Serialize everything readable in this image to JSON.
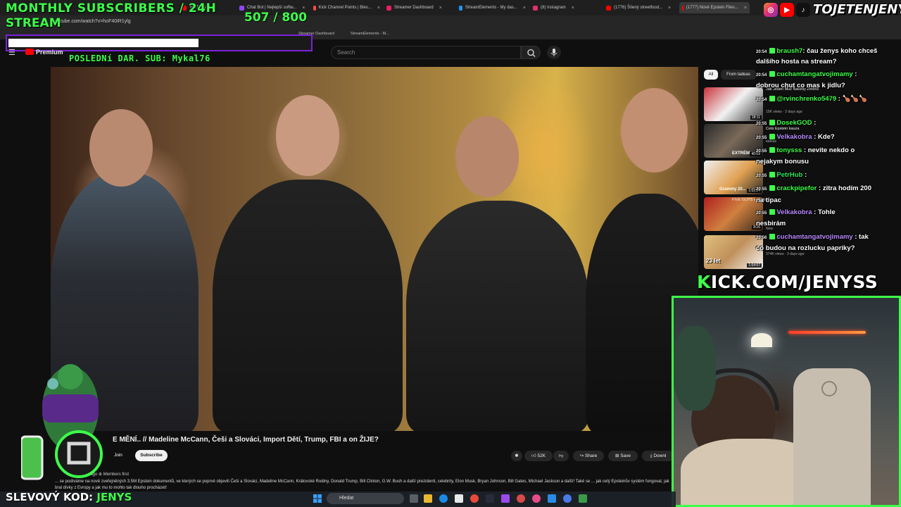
{
  "browser": {
    "tabs": [
      {
        "label": "YouTube",
        "color": "#ff0000"
      },
      {
        "label": "Chat Bot | Nejlepší softw...",
        "color": "#9146ff"
      },
      {
        "label": "Kick Channel Points | Bles...",
        "color": "#ff4a4a"
      },
      {
        "label": "Streamer Dashboard",
        "color": "#e91e63"
      },
      {
        "label": "StreamElements - My das...",
        "color": "#2196f3"
      },
      {
        "label": "(8) Instagram",
        "color": "#e1306c"
      },
      {
        "label": "(1776) Šílený streetfood...",
        "color": "#ff0000"
      },
      {
        "label": "(1777) Nové Epstein Files...",
        "color": "#ff0000"
      }
    ],
    "url": "outube.com/watch?v=hoF40iR1ylg",
    "bookmarks": [
      "Streamer Dashboard",
      "StreamElements - M..."
    ]
  },
  "overlay": {
    "sub_goal_line1": "MONTHLY SUBSCRIBERS / 24H",
    "sub_goal_line2": "STREAM",
    "sub_goal_count": "507 / 800",
    "sub_goal_progress": 0.63,
    "last_sub": "POSLEDNí DAR. SUB: Mykal76",
    "social_handle": "TOJETENJENYS",
    "kick_url_k": "K",
    "kick_url_rest": "ICK.COM/JENYSS",
    "discount_label": "SLEVOVÝ KOD:",
    "discount_code": "JENYS",
    "accent": "#3dff4a",
    "goal_border": "#7a22d8"
  },
  "youtube": {
    "logo_text": "Premium",
    "search_placeholder": "Search",
    "video_title": "E MĚNÍ.. // Madeline McCann, Češi a Slováci, Import Dětí, Trump, FBI a on ŽIJE?",
    "join_label": "Join",
    "subscribe_label": "Subscribe",
    "likes": "52K",
    "share_label": "Share",
    "save_label": "Save",
    "download_label": "Downl",
    "channel_meta": "2 d...ago   ⊕ Members first",
    "description": "... se podíváme na nově zveřejněných 3.5M Epstein dokumentů, ve kterých se poprvé objevili Češi a Slováci, Madeline McCann, Královské Rodiny, Donald Trump, Bill Clinton, G.W. Bush a další prezidenti, celebrity, Elon Musk, Bryan Johnson, Bill Gates, Michael Jackson a další! Také se ... jak celý Epsteinův systém fungoval, jak bral dívky z Evropy a jak mu to mohlo tak dlouho procházet!",
    "chips": [
      "All",
      "From tadeas"
    ],
    "recommendations": [
      {
        "title": "Jak Jeden Muž Navždy Změnil",
        "meta": "15K views · 2 days ago",
        "duration": "18:11"
      },
      {
        "title": "Celá Epstein kauza",
        "meta": "tadeas",
        "duration": "40:09"
      },
      {
        "title": "Dělal jsem ...",
        "meta": "",
        "duration": "1:02:24"
      },
      {
        "title": "FIVE GUYS v česku",
        "meta": "New",
        "duration": "8:26"
      },
      {
        "title": "...",
        "meta": "374K views · 3 days ago",
        "duration": "1:04:57"
      }
    ],
    "rec_labels": [
      "EXTRÉM",
      "Grammy 20...",
      "23 let"
    ]
  },
  "chat": [
    {
      "time": "20:54",
      "user": "braush7",
      "msg": "čau ženys koho chceš",
      "msg2": "dalšího hosta na stream?",
      "style": "green"
    },
    {
      "time": "20:54",
      "user": "cuchamtangatvojimamy",
      "msg": ":",
      "msg2": "dobrou chut co mas k jidlu?",
      "style": "purple"
    },
    {
      "time": "20:54",
      "user": "@rvinchrenko5479",
      "msg": ": 🍗🍗🍗",
      "msg2": "",
      "style": "green"
    },
    {
      "time": "20:55",
      "user": "DosekGOD",
      "msg": ":",
      "msg2": "",
      "style": "green"
    },
    {
      "time": "20:55",
      "user": "Velkakobra",
      "msg": ": Kde?",
      "msg2": "",
      "style": "purple"
    },
    {
      "time": "20:55",
      "user": "tonysss",
      "msg": ": nevite nekdo o",
      "msg2": "nejakym bonusu",
      "style": "green"
    },
    {
      "time": "20:55",
      "user": "PetrHub",
      "msg": ":",
      "msg2": "",
      "style": "green2"
    },
    {
      "time": "20:55",
      "user": "crackpipefor",
      "msg": ": zitra hodím 200",
      "msg2": "",
      "style": "green"
    },
    {
      "time": "20:55",
      "user": "na tipac",
      "msg": "",
      "msg2": "",
      "style": "plain"
    },
    {
      "time": "20:55",
      "user": "Velkakobra",
      "msg": ": Tohle",
      "msg2": "nesbirám",
      "style": "purple"
    },
    {
      "time": "20:56",
      "user": "cuchamtangatvojimamy",
      "msg": ": tak",
      "msg2": "co budou na rozlucku papriky?",
      "style": "purple"
    }
  ],
  "taskbar": {
    "search_placeholder": "Hledat"
  }
}
